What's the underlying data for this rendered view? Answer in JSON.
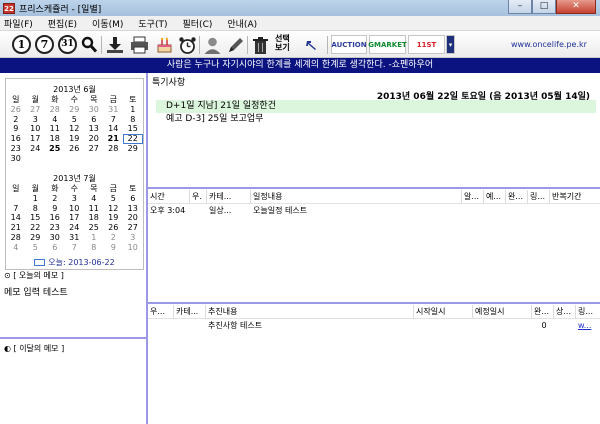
{
  "window": {
    "app_icon": "22",
    "title": "프리스케쥴러 - [일별]",
    "min": "–",
    "max": "□",
    "close": "✕"
  },
  "menu": [
    "파일(F)",
    "편집(E)",
    "이동(M)",
    "도구(T)",
    "필터(C)",
    "안내(A)"
  ],
  "toolbar": {
    "day_label": "1",
    "week_label": "7",
    "month_label": "31",
    "select_view_line1": "선택",
    "select_view_line2": "보기",
    "banner_auction": "AUCTION",
    "banner_gmarket": "GMARKET",
    "banner_11st": "11ST",
    "url": "www.oncelife.pe.kr"
  },
  "slogan": "사람은 누구나 자기시야의 한계를 세계의 한계로 생각한다. -쇼펜하우어",
  "calendar": {
    "weekdays": [
      "일",
      "월",
      "화",
      "수",
      "목",
      "금",
      "토"
    ],
    "months": [
      {
        "title": "2013년 6월",
        "weeks": [
          [
            {
              "d": "26",
              "o": true
            },
            {
              "d": "27",
              "o": true
            },
            {
              "d": "28",
              "o": true
            },
            {
              "d": "29",
              "o": true
            },
            {
              "d": "30",
              "o": true
            },
            {
              "d": "31",
              "o": true
            },
            {
              "d": "1"
            }
          ],
          [
            {
              "d": "2"
            },
            {
              "d": "3"
            },
            {
              "d": "4"
            },
            {
              "d": "5"
            },
            {
              "d": "6"
            },
            {
              "d": "7"
            },
            {
              "d": "8"
            }
          ],
          [
            {
              "d": "9"
            },
            {
              "d": "10"
            },
            {
              "d": "11"
            },
            {
              "d": "12"
            },
            {
              "d": "13"
            },
            {
              "d": "14"
            },
            {
              "d": "15"
            }
          ],
          [
            {
              "d": "16"
            },
            {
              "d": "17"
            },
            {
              "d": "18"
            },
            {
              "d": "19"
            },
            {
              "d": "20"
            },
            {
              "d": "21",
              "b": true
            },
            {
              "d": "22",
              "t": true
            }
          ],
          [
            {
              "d": "23"
            },
            {
              "d": "24"
            },
            {
              "d": "25",
              "b": true
            },
            {
              "d": "26"
            },
            {
              "d": "27"
            },
            {
              "d": "28"
            },
            {
              "d": "29"
            }
          ],
          [
            {
              "d": "30"
            }
          ]
        ]
      },
      {
        "title": "2013년 7월",
        "weeks": [
          [
            {
              "d": ""
            },
            {
              "d": "1"
            },
            {
              "d": "2"
            },
            {
              "d": "3"
            },
            {
              "d": "4"
            },
            {
              "d": "5"
            },
            {
              "d": "6"
            }
          ],
          [
            {
              "d": "7"
            },
            {
              "d": "8"
            },
            {
              "d": "9"
            },
            {
              "d": "10"
            },
            {
              "d": "11"
            },
            {
              "d": "12"
            },
            {
              "d": "13"
            }
          ],
          [
            {
              "d": "14"
            },
            {
              "d": "15"
            },
            {
              "d": "16"
            },
            {
              "d": "17"
            },
            {
              "d": "18"
            },
            {
              "d": "19"
            },
            {
              "d": "20"
            }
          ],
          [
            {
              "d": "21"
            },
            {
              "d": "22"
            },
            {
              "d": "23"
            },
            {
              "d": "24"
            },
            {
              "d": "25"
            },
            {
              "d": "26"
            },
            {
              "d": "27"
            }
          ],
          [
            {
              "d": "28"
            },
            {
              "d": "29"
            },
            {
              "d": "30"
            },
            {
              "d": "31"
            },
            {
              "d": "1",
              "o": true
            },
            {
              "d": "2",
              "o": true
            },
            {
              "d": "3",
              "o": true
            }
          ],
          [
            {
              "d": "4",
              "o": true
            },
            {
              "d": "5",
              "o": true
            },
            {
              "d": "6",
              "o": true
            },
            {
              "d": "7",
              "o": true
            },
            {
              "d": "8",
              "o": true
            },
            {
              "d": "9",
              "o": true
            },
            {
              "d": "10",
              "o": true
            }
          ]
        ]
      }
    ],
    "today_label": "오늘: 2013-06-22"
  },
  "today_memo": {
    "header": "[ 오늘의 메모 ]",
    "text": "메모 입력 테스트"
  },
  "month_memo": {
    "header": "[ 이달의 메모 ]"
  },
  "special": {
    "title": "특기사항",
    "date_line": "2013년 06월 22일 토요일   (음 2013년 05월 14일)",
    "items": [
      "D+1일 지남] 21일 일정한건",
      "예고 D-3] 25일 보고업무"
    ]
  },
  "schedule": {
    "columns": [
      "시간",
      "우.",
      "카테...",
      "일정내용",
      "알...",
      "예...",
      "완...",
      "링...",
      "반복기간"
    ],
    "rows": [
      [
        "오후 3:04",
        "",
        "일상...",
        "오늘일정 테스트",
        "",
        "",
        "",
        "",
        ""
      ]
    ]
  },
  "tasks": {
    "columns": [
      "우...",
      "카테...",
      "추진내용",
      "시작일시",
      "예정일시",
      "완...",
      "상...",
      "링..."
    ],
    "rows": [
      [
        "",
        "",
        "추진사항 테스트",
        "",
        "",
        "0",
        "",
        "w..."
      ]
    ]
  }
}
